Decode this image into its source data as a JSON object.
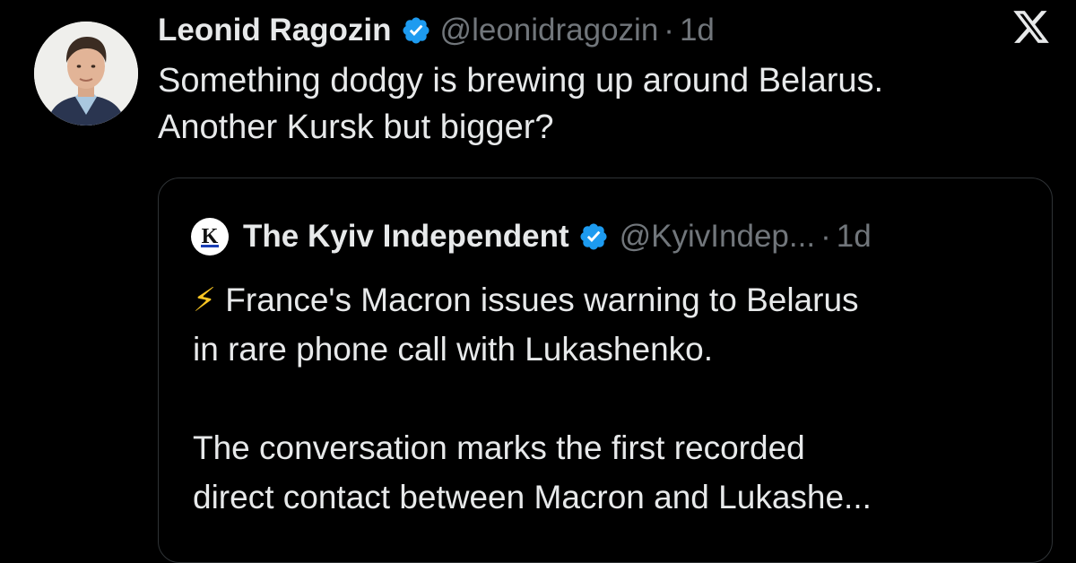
{
  "tweet": {
    "author_name": "Leonid Ragozin",
    "handle": "@leonidragozin",
    "separator": "·",
    "time": "1d",
    "text_lines": [
      "Something dodgy is brewing up around Belarus.",
      "Another Kursk but bigger?"
    ],
    "verified_icon": "verified-badge-icon",
    "platform_icon": "x-logo-icon",
    "verified_color": "#1d9bf0"
  },
  "quoted": {
    "author_name": "The Kyiv Independent",
    "handle": "@KyivIndep...",
    "separator": "·",
    "time": "1d",
    "avatar_letter": "K",
    "bolt": "⚡",
    "line1": "France's Macron issues warning to Belarus",
    "line2": "in rare phone call with Lukashenko.",
    "line3": "The conversation marks the first recorded",
    "line4": "direct contact between Macron and Lukashe..."
  }
}
